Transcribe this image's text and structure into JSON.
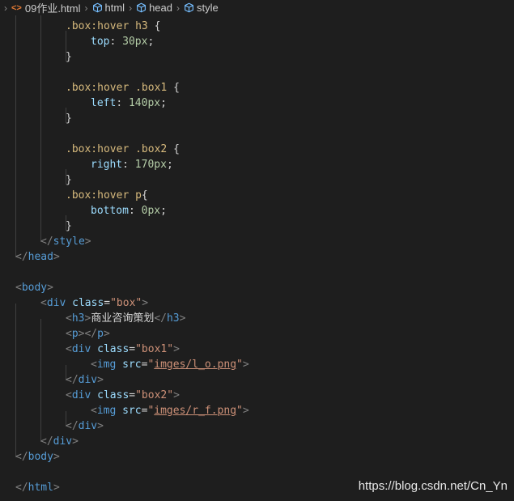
{
  "breadcrumb": {
    "file_icon": "<>",
    "file": "09作业.html",
    "items": [
      "html",
      "head",
      "style"
    ]
  },
  "code_lines": [
    [
      {
        "t": ".box:hover h3 ",
        "c": "sel"
      },
      {
        "t": "{",
        "c": "punc"
      }
    ],
    [
      {
        "t": "top",
        "c": "prop"
      },
      {
        "t": ": ",
        "c": "punc"
      },
      {
        "t": "30px",
        "c": "num"
      },
      {
        "t": ";",
        "c": "punc"
      }
    ],
    [
      {
        "t": "}",
        "c": "punc"
      }
    ],
    [],
    [
      {
        "t": ".box:hover .box1 ",
        "c": "sel"
      },
      {
        "t": "{",
        "c": "punc"
      }
    ],
    [
      {
        "t": "left",
        "c": "prop"
      },
      {
        "t": ": ",
        "c": "punc"
      },
      {
        "t": "140px",
        "c": "num"
      },
      {
        "t": ";",
        "c": "punc"
      }
    ],
    [
      {
        "t": "}",
        "c": "punc"
      }
    ],
    [],
    [
      {
        "t": ".box:hover .box2 ",
        "c": "sel"
      },
      {
        "t": "{",
        "c": "punc"
      }
    ],
    [
      {
        "t": "right",
        "c": "prop"
      },
      {
        "t": ": ",
        "c": "punc"
      },
      {
        "t": "170px",
        "c": "num"
      },
      {
        "t": ";",
        "c": "punc"
      }
    ],
    [
      {
        "t": "}",
        "c": "punc"
      }
    ],
    [
      {
        "t": ".box:hover p",
        "c": "sel"
      },
      {
        "t": "{",
        "c": "punc"
      }
    ],
    [
      {
        "t": "bottom",
        "c": "prop"
      },
      {
        "t": ": ",
        "c": "punc"
      },
      {
        "t": "0px",
        "c": "num"
      },
      {
        "t": ";",
        "c": "punc"
      }
    ],
    [
      {
        "t": "}",
        "c": "punc"
      }
    ],
    [
      {
        "t": "</",
        "c": "tagp"
      },
      {
        "t": "style",
        "c": "tag"
      },
      {
        "t": ">",
        "c": "tagp"
      }
    ],
    [
      {
        "t": "</",
        "c": "tagp"
      },
      {
        "t": "head",
        "c": "tag"
      },
      {
        "t": ">",
        "c": "tagp"
      }
    ],
    [],
    [
      {
        "t": "<",
        "c": "tagp"
      },
      {
        "t": "body",
        "c": "tag"
      },
      {
        "t": ">",
        "c": "tagp"
      }
    ],
    [
      {
        "t": "<",
        "c": "tagp"
      },
      {
        "t": "div",
        "c": "tag"
      },
      {
        "t": " ",
        "c": "punc"
      },
      {
        "t": "class",
        "c": "attr"
      },
      {
        "t": "=",
        "c": "punc"
      },
      {
        "t": "\"box\"",
        "c": "str"
      },
      {
        "t": ">",
        "c": "tagp"
      }
    ],
    [
      {
        "t": "<",
        "c": "tagp"
      },
      {
        "t": "h3",
        "c": "tag"
      },
      {
        "t": ">",
        "c": "tagp"
      },
      {
        "t": "商业咨询策划",
        "c": "text"
      },
      {
        "t": "</",
        "c": "tagp"
      },
      {
        "t": "h3",
        "c": "tag"
      },
      {
        "t": ">",
        "c": "tagp"
      }
    ],
    [
      {
        "t": "<",
        "c": "tagp"
      },
      {
        "t": "p",
        "c": "tag"
      },
      {
        "t": "></",
        "c": "tagp"
      },
      {
        "t": "p",
        "c": "tag"
      },
      {
        "t": ">",
        "c": "tagp"
      }
    ],
    [
      {
        "t": "<",
        "c": "tagp"
      },
      {
        "t": "div",
        "c": "tag"
      },
      {
        "t": " ",
        "c": "punc"
      },
      {
        "t": "class",
        "c": "attr"
      },
      {
        "t": "=",
        "c": "punc"
      },
      {
        "t": "\"box1\"",
        "c": "str"
      },
      {
        "t": ">",
        "c": "tagp"
      }
    ],
    [
      {
        "t": "<",
        "c": "tagp"
      },
      {
        "t": "img",
        "c": "tag"
      },
      {
        "t": " ",
        "c": "punc"
      },
      {
        "t": "src",
        "c": "attr"
      },
      {
        "t": "=",
        "c": "punc"
      },
      {
        "t": "\"",
        "c": "str"
      },
      {
        "t": "imges/l_o.png",
        "c": "link"
      },
      {
        "t": "\"",
        "c": "str"
      },
      {
        "t": ">",
        "c": "tagp"
      }
    ],
    [
      {
        "t": "</",
        "c": "tagp"
      },
      {
        "t": "div",
        "c": "tag"
      },
      {
        "t": ">",
        "c": "tagp"
      }
    ],
    [
      {
        "t": "<",
        "c": "tagp"
      },
      {
        "t": "div",
        "c": "tag"
      },
      {
        "t": " ",
        "c": "punc"
      },
      {
        "t": "class",
        "c": "attr"
      },
      {
        "t": "=",
        "c": "punc"
      },
      {
        "t": "\"box2\"",
        "c": "str"
      },
      {
        "t": ">",
        "c": "tagp"
      }
    ],
    [
      {
        "t": "<",
        "c": "tagp"
      },
      {
        "t": "img",
        "c": "tag"
      },
      {
        "t": " ",
        "c": "punc"
      },
      {
        "t": "src",
        "c": "attr"
      },
      {
        "t": "=",
        "c": "punc"
      },
      {
        "t": "\"",
        "c": "str"
      },
      {
        "t": "imges/r_f.png",
        "c": "link"
      },
      {
        "t": "\"",
        "c": "str"
      },
      {
        "t": ">",
        "c": "tagp"
      }
    ],
    [
      {
        "t": "</",
        "c": "tagp"
      },
      {
        "t": "div",
        "c": "tag"
      },
      {
        "t": ">",
        "c": "tagp"
      }
    ],
    [
      {
        "t": "</",
        "c": "tagp"
      },
      {
        "t": "div",
        "c": "tag"
      },
      {
        "t": ">",
        "c": "tagp"
      }
    ],
    [
      {
        "t": "</",
        "c": "tagp"
      },
      {
        "t": "body",
        "c": "tag"
      },
      {
        "t": ">",
        "c": "tagp"
      }
    ],
    [],
    [
      {
        "t": "</",
        "c": "tagp"
      },
      {
        "t": "html",
        "c": "tag"
      },
      {
        "t": ">",
        "c": "tagp"
      }
    ]
  ],
  "watermark": "https://blog.csdn.net/Cn_Yn"
}
